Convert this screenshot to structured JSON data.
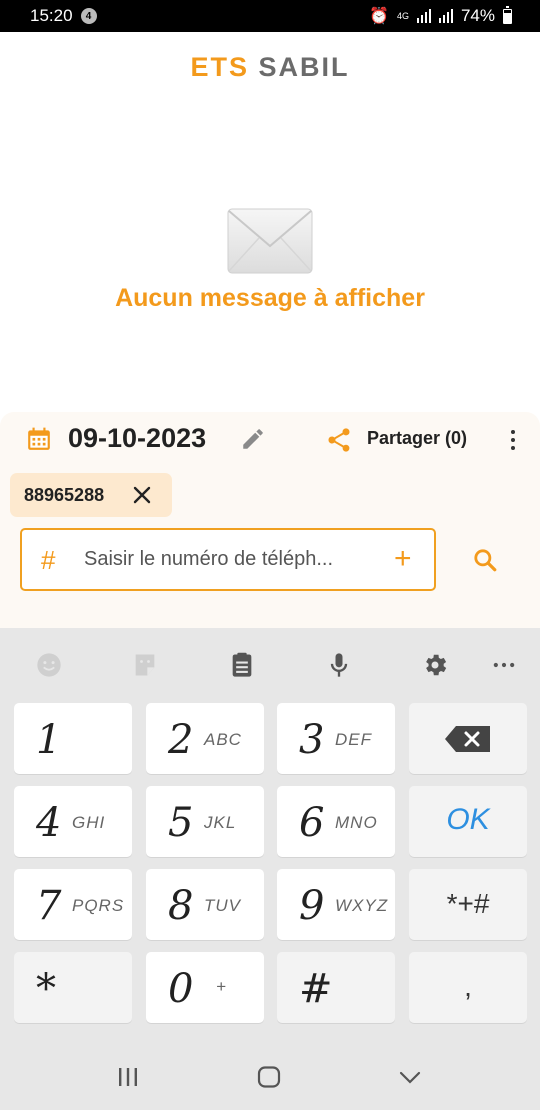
{
  "status_bar": {
    "time": "15:20",
    "notification": "4",
    "network": "4G",
    "battery": "74%"
  },
  "app": {
    "title_part1": "ETS",
    "title_part2": "SABIL",
    "accent_color": "#f39a1c"
  },
  "empty_state": {
    "icon": "envelope-icon",
    "message": "Aucun message à afficher"
  },
  "panel": {
    "date": "09-10-2023",
    "share_label": "Partager (0)",
    "chip": {
      "number": "88965288"
    },
    "phone_input": {
      "placeholder": "Saisir le numéro de téléph..."
    }
  },
  "keyboard": {
    "toolbar": [
      "emoji-icon",
      "sticker-icon",
      "clipboard-icon",
      "mic-icon",
      "settings-icon",
      "more-icon"
    ],
    "keys": [
      {
        "digit": "1",
        "letters": ""
      },
      {
        "digit": "2",
        "letters": "ABC"
      },
      {
        "digit": "3",
        "letters": "DEF"
      },
      {
        "digit": "4",
        "letters": "GHI"
      },
      {
        "digit": "5",
        "letters": "JKL"
      },
      {
        "digit": "6",
        "letters": "MNO"
      },
      {
        "digit": "7",
        "letters": "PQRS"
      },
      {
        "digit": "8",
        "letters": "TUV"
      },
      {
        "digit": "9",
        "letters": "WXYZ"
      },
      {
        "digit": "*",
        "letters": ""
      },
      {
        "digit": "0",
        "letters": "+"
      },
      {
        "digit": "#",
        "letters": ""
      }
    ],
    "ok_label": "OK",
    "symbols_label": "*+#",
    "comma_label": ","
  }
}
